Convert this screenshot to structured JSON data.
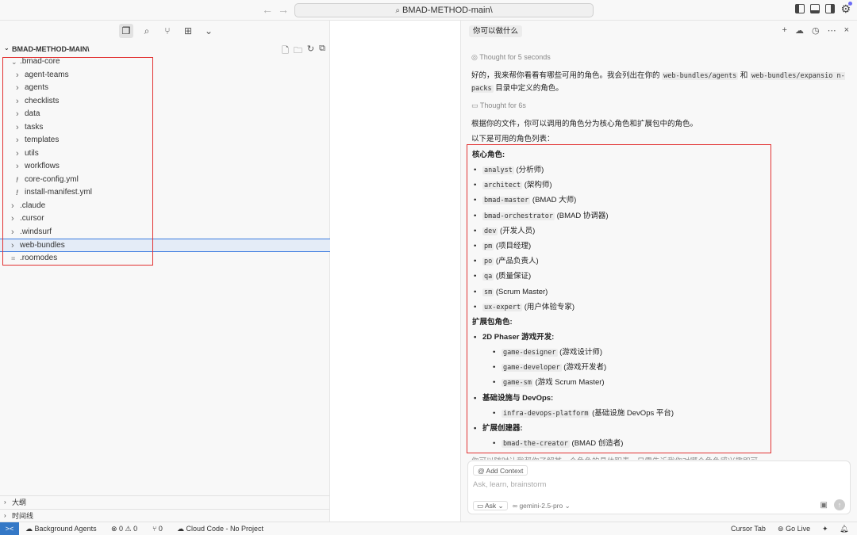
{
  "titlebar": {
    "search_text": "BMAD-METHOD-main\\",
    "back_arrow": "←",
    "forward_arrow": "→"
  },
  "explorer": {
    "root_label": "BMAD-METHOD-MAIN\\",
    "tree": [
      {
        "label": ".bmad-core",
        "type": "folder-open",
        "indent": 1
      },
      {
        "label": "agent-teams",
        "type": "folder",
        "indent": 2
      },
      {
        "label": "agents",
        "type": "folder",
        "indent": 2
      },
      {
        "label": "checklists",
        "type": "folder",
        "indent": 2
      },
      {
        "label": "data",
        "type": "folder",
        "indent": 2
      },
      {
        "label": "tasks",
        "type": "folder",
        "indent": 2
      },
      {
        "label": "templates",
        "type": "folder",
        "indent": 2
      },
      {
        "label": "utils",
        "type": "folder",
        "indent": 2
      },
      {
        "label": "workflows",
        "type": "folder",
        "indent": 2
      },
      {
        "label": "core-config.yml",
        "type": "yml",
        "indent": 2
      },
      {
        "label": "install-manifest.yml",
        "type": "yml",
        "indent": 2
      },
      {
        "label": ".claude",
        "type": "folder",
        "indent": 1
      },
      {
        "label": ".cursor",
        "type": "folder",
        "indent": 1
      },
      {
        "label": ".windsurf",
        "type": "folder",
        "indent": 1
      },
      {
        "label": "web-bundles",
        "type": "folder",
        "indent": 1,
        "selected": true
      },
      {
        "label": ".roomodes",
        "type": "file",
        "indent": 1
      }
    ],
    "outline_label": "大纲",
    "timeline_label": "时间线"
  },
  "chat": {
    "tab_title": "你可以做什么",
    "thought1": "Thought for 5 seconds",
    "intro_a": "好的，我来帮你看看有哪些可用的角色。我会列出在你的 ",
    "intro_code1": "web-bundles/agents",
    "intro_b": " 和 ",
    "intro_code2": "web-bundles/expansio n-packs",
    "intro_c": " 目录中定义的角色。",
    "thought2": "Thought for 6s",
    "summary1": "根据你的文件，你可以调用的角色分为核心角色和扩展包中的角色。",
    "summary2": "以下是可用的角色列表：",
    "core_heading": "核心角色:",
    "core_roles": [
      {
        "code": "analyst",
        "desc": " (分析师)"
      },
      {
        "code": "architect",
        "desc": " (架构师)"
      },
      {
        "code": "bmad-master",
        "desc": " (BMAD 大师)"
      },
      {
        "code": "bmad-orchestrator",
        "desc": " (BMAD 协调器)"
      },
      {
        "code": "dev",
        "desc": " (开发人员)"
      },
      {
        "code": "pm",
        "desc": " (项目经理)"
      },
      {
        "code": "po",
        "desc": " (产品负责人)"
      },
      {
        "code": "qa",
        "desc": " (质量保证)"
      },
      {
        "code": "sm",
        "desc": " (Scrum Master)"
      },
      {
        "code": "ux-expert",
        "desc": " (用户体验专家)"
      }
    ],
    "ext_heading": "扩展包角色:",
    "ext_groups": [
      {
        "name": "2D Phaser 游戏开发:",
        "roles": [
          {
            "code": "game-designer",
            "desc": " (游戏设计师)"
          },
          {
            "code": "game-developer",
            "desc": " (游戏开发者)"
          },
          {
            "code": "game-sm",
            "desc": " (游戏 Scrum Master)"
          }
        ]
      },
      {
        "name": "基础设施与 DevOps:",
        "roles": [
          {
            "code": "infra-devops-platform",
            "desc": " (基础设施 DevOps 平台)"
          }
        ]
      },
      {
        "name": "扩展创建器:",
        "roles": [
          {
            "code": "bmad-the-creator",
            "desc": " (BMAD 创造者)"
          }
        ]
      }
    ],
    "cutoff_text": "你可以随时让我帮你了解某一个角色的具体职责，只需告诉我你对哪个角色感兴趣即可。",
    "add_context": "@ Add Context",
    "placeholder": "Ask, learn, brainstorm",
    "mode": "Ask",
    "model": "gemini-2.5-pro"
  },
  "statusbar": {
    "remote_icon": "><",
    "background_agents": "Background Agents",
    "problems": "⊗ 0 ⚠ 0",
    "ports": "⑂ 0",
    "cloud_code": "Cloud Code - No Project",
    "cursor_tab": "Cursor Tab",
    "go_live": "Go Live"
  }
}
